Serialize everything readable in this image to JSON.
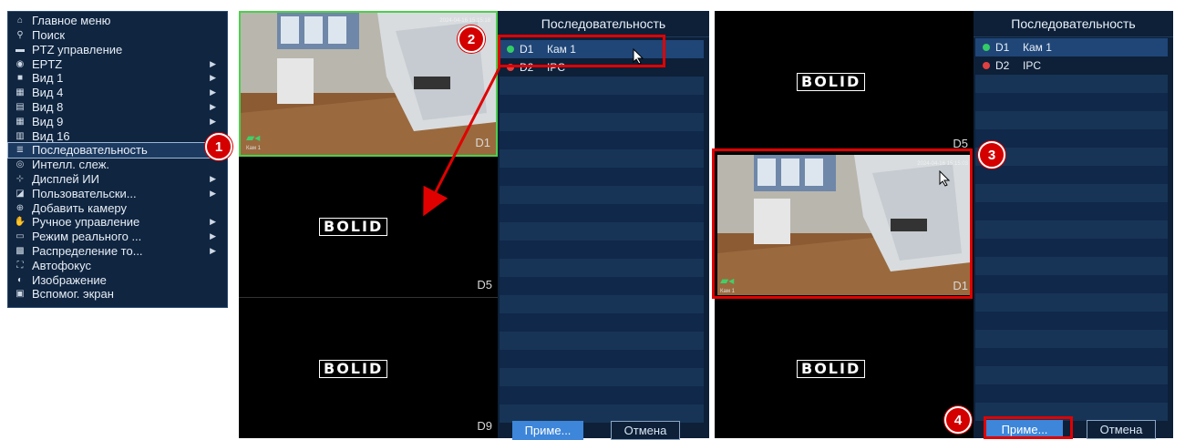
{
  "menu": {
    "items": [
      {
        "icon": "home-icon",
        "glyph": "⌂",
        "label": "Главное меню",
        "submenu": false
      },
      {
        "icon": "search-icon",
        "glyph": "⚲",
        "label": "Поиск",
        "submenu": false
      },
      {
        "icon": "ptz-icon",
        "glyph": "▬",
        "label": "PTZ управление",
        "submenu": false
      },
      {
        "icon": "eptz-icon",
        "glyph": "◉",
        "label": "EPTZ",
        "submenu": true
      },
      {
        "icon": "view1-icon",
        "glyph": "■",
        "label": "Вид 1",
        "submenu": true
      },
      {
        "icon": "view4-icon",
        "glyph": "▦",
        "label": "Вид 4",
        "submenu": true
      },
      {
        "icon": "view8-icon",
        "glyph": "▤",
        "label": "Вид 8",
        "submenu": true
      },
      {
        "icon": "view9-icon",
        "glyph": "▦",
        "label": "Вид 9",
        "submenu": true
      },
      {
        "icon": "view16-icon",
        "glyph": "▥",
        "label": "Вид 16",
        "submenu": false
      },
      {
        "icon": "sequence-icon",
        "glyph": "≣",
        "label": "Последовательность",
        "submenu": false,
        "selected": true
      },
      {
        "icon": "tracking-icon",
        "glyph": "◎",
        "label": "Интелл. слеж.",
        "submenu": false
      },
      {
        "icon": "ai-display-icon",
        "glyph": "⊹",
        "label": "Дисплей ИИ",
        "submenu": true
      },
      {
        "icon": "custom-icon",
        "glyph": "◪",
        "label": "Пользовательски...",
        "submenu": true
      },
      {
        "icon": "add-camera-icon",
        "glyph": "⊕",
        "label": "Добавить камеру",
        "submenu": false
      },
      {
        "icon": "manual-icon",
        "glyph": "✋",
        "label": "Ручное управление",
        "submenu": true
      },
      {
        "icon": "realtime-icon",
        "glyph": "▭",
        "label": "Режим реального ...",
        "submenu": true
      },
      {
        "icon": "stream-icon",
        "glyph": "▩",
        "label": "Распределение то...",
        "submenu": true
      },
      {
        "icon": "autofocus-icon",
        "glyph": "⛶",
        "label": "Автофокус",
        "submenu": false
      },
      {
        "icon": "image-icon",
        "glyph": "◐",
        "label": "Изображение",
        "submenu": false
      },
      {
        "icon": "aux-screen-icon",
        "glyph": "▣",
        "label": "Вспомог. экран",
        "submenu": false
      }
    ]
  },
  "screen1": {
    "tiles": [
      {
        "label": "D1",
        "camera": "Кам 1",
        "timestamp": "2024-04-16 15:15:18"
      },
      {
        "label": "D5",
        "logo": "BOLID"
      },
      {
        "label": "D9",
        "logo": "BOLID"
      }
    ],
    "panel": {
      "title": "Последовательность",
      "items": [
        {
          "id": "D1",
          "name": "Кам 1",
          "status_color": "#33cc66",
          "selected": true
        },
        {
          "id": "D2",
          "name": "IPC",
          "status_color": "#e04040"
        }
      ],
      "apply_label": "Приме...",
      "cancel_label": "Отмена"
    }
  },
  "screen2": {
    "tiles": [
      {
        "label": "D5",
        "logo": "BOLID"
      },
      {
        "label": "D1",
        "camera": "Кам 1",
        "timestamp": "2024-04-16 15:15:03"
      },
      {
        "label": "",
        "logo": "BOLID"
      }
    ],
    "panel": {
      "title": "Последовательность",
      "items": [
        {
          "id": "D1",
          "name": "Кам 1",
          "status_color": "#33cc66",
          "selected": true
        },
        {
          "id": "D2",
          "name": "IPC",
          "status_color": "#e04040"
        }
      ],
      "apply_label": "Приме...",
      "cancel_label": "Отмена"
    }
  },
  "annotations": [
    "1",
    "2",
    "3",
    "4"
  ],
  "colors": {
    "annotation_red": "#e10000",
    "menu_bg": "#0f2540",
    "panel_bg": "#0d2038",
    "apply_blue": "#3d86d9"
  }
}
